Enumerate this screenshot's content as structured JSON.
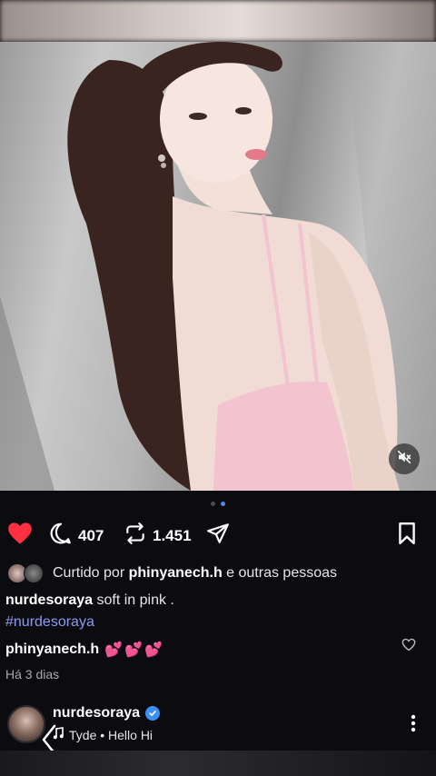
{
  "post": {
    "media_index": 2,
    "media_count": 2,
    "muted": true
  },
  "actions": {
    "comment_count": "407",
    "repost_count": "1.451"
  },
  "likes": {
    "prefix": "Curtido por ",
    "user": "phinyanech.h",
    "suffix": " e outras pessoas"
  },
  "caption": {
    "author": "nurdesoraya",
    "text": " soft in pink .",
    "hashtag": "#nurdesoraya"
  },
  "comment": {
    "author": "phinyanech.h",
    "text": "💕💕💕"
  },
  "timestamp": "Há 3 dias",
  "next_post": {
    "author": "nurdesoraya",
    "verified": true,
    "music": "Tyde • Hello Hi"
  },
  "colors": {
    "like_red": "#ff3040",
    "link_blue": "#8a9cf2",
    "verified_blue": "#3d8ff7",
    "background": "#0c0c10"
  },
  "icons": [
    "heart-icon",
    "comment-icon",
    "repost-icon",
    "share-icon",
    "bookmark-icon",
    "mute-icon",
    "comment-like-icon",
    "more-icon",
    "music-note-icon",
    "back-chevron-icon"
  ]
}
